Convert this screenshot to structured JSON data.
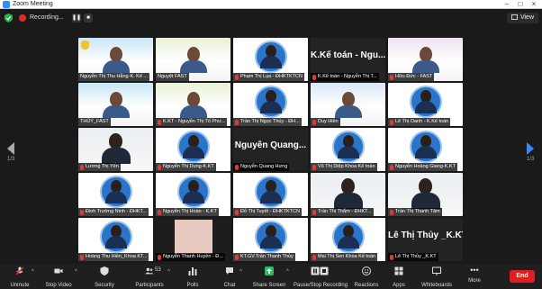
{
  "window": {
    "title": "Zoom Meeting"
  },
  "topbar": {
    "recording_label": "Recording...",
    "view_label": "View"
  },
  "pager": {
    "left_count": "1/3",
    "right_count": "1/3"
  },
  "tiles": [
    {
      "name": "Nguyễn Thị Thu Hằng-K. Kế ...",
      "type": "poster",
      "active": true,
      "muted": false
    },
    {
      "name": "Nguyệt FAST",
      "type": "poster",
      "muted": false
    },
    {
      "name": "Phạm Thị Lụa - ĐHKTKTCN",
      "type": "badge",
      "muted": true
    },
    {
      "name": "K.Kế toán - Nguyễn Thị T...",
      "type": "text",
      "big": "K.Kế toán - Ngu...",
      "muted": true
    },
    {
      "name": "Hữu Đức - FAST",
      "type": "poster",
      "muted": true
    },
    {
      "name": "THỦY_FAST",
      "type": "poster",
      "muted": false
    },
    {
      "name": "K.KT - Nguyễn Thị Tố Phư...",
      "type": "poster",
      "muted": true
    },
    {
      "name": "Trần Thị Ngọc Thúy - ĐH...",
      "type": "badge",
      "muted": true
    },
    {
      "name": "Duy Hiền",
      "type": "poster",
      "muted": true
    },
    {
      "name": "Lê Thị Oanh - K.Kế toán",
      "type": "badge",
      "muted": true
    },
    {
      "name": "Lương Thị Yến",
      "type": "photo",
      "muted": true
    },
    {
      "name": "Nguyễn Thị Dung-K.KT",
      "type": "badge",
      "muted": true
    },
    {
      "name": "Nguyễn Quang Hưng",
      "type": "text",
      "big": "Nguyễn Quang...",
      "muted": true
    },
    {
      "name": "Vũ Thị Diệp Khoa Kế toán",
      "type": "badge",
      "muted": true
    },
    {
      "name": "Nguyễn Hoàng Giang-K.KT",
      "type": "badge",
      "muted": true
    },
    {
      "name": "Đinh Trường Ninh - ĐHKT...",
      "type": "badge",
      "muted": true
    },
    {
      "name": "Nguyễn Thị Hoàn - K.KT",
      "type": "badge",
      "muted": true
    },
    {
      "name": "Đỗ Thị Tuyết - ĐHKTKTCN",
      "type": "badge",
      "muted": true
    },
    {
      "name": "Trần Thị Thắm - ĐHKT...",
      "type": "photo",
      "muted": true
    },
    {
      "name": "Trần Thị Thanh Tâm",
      "type": "photo",
      "muted": true
    },
    {
      "name": "Hoàng Thu Hiền_Khoa KT...",
      "type": "badge",
      "muted": true
    },
    {
      "name": "Nguyễn Thanh Huyền - Đ...",
      "type": "plain",
      "muted": true
    },
    {
      "name": "KT.GV.Trần Thanh Thủy",
      "type": "badge",
      "muted": true
    },
    {
      "name": "Mai Thị Sen Khoa Kế toán",
      "type": "badge",
      "muted": true
    },
    {
      "name": "Lê Thị Thủy _K.KT",
      "type": "text",
      "big": "Lê Thị Thủy _K.KT",
      "muted": true
    }
  ],
  "toolbar": {
    "unmute": "Unmute",
    "stop_video": "Stop Video",
    "security": "Security",
    "participants": "Participants",
    "participants_count": "53",
    "polls": "Polls",
    "chat": "Chat",
    "share_screen": "Share Screen",
    "recording": "Pause/Stop Recording",
    "reactions": "Reactions",
    "apps": "Apps",
    "whiteboards": "Whiteboards",
    "more": "More",
    "end": "End"
  },
  "colors": {
    "share_green": "#21c25e",
    "end_red": "#e0201e",
    "active_outline": "#d4c82c",
    "arrow_blue": "#2d8cff"
  }
}
